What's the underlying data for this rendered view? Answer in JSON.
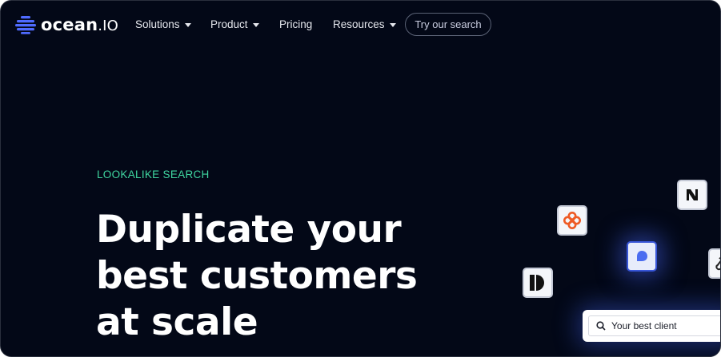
{
  "nav": {
    "logo_main": "ocean",
    "logo_suffix": ".IO",
    "items": [
      {
        "label": "Solutions"
      },
      {
        "label": "Product"
      },
      {
        "label": "Pricing"
      },
      {
        "label": "Resources"
      }
    ],
    "cta_label": "Try our search"
  },
  "hero": {
    "eyebrow": "LOOKALIKE SEARCH",
    "headline_lines": [
      "Duplicate your",
      "best customers",
      "at scale"
    ]
  },
  "search_card": {
    "value": "Your best client"
  },
  "colors": {
    "background": "#030817",
    "accent_green": "#3fd6a0",
    "brand_blue": "#3856d8",
    "logo_blue": "#4f6bff"
  },
  "icons": [
    "ocean-logo-icon",
    "chevron-down-icon",
    "flower-logo-icon",
    "half-circle-logo-icon",
    "chat-bubble-logo-icon",
    "n-logo-icon",
    "link-logo-icon",
    "search-icon"
  ]
}
